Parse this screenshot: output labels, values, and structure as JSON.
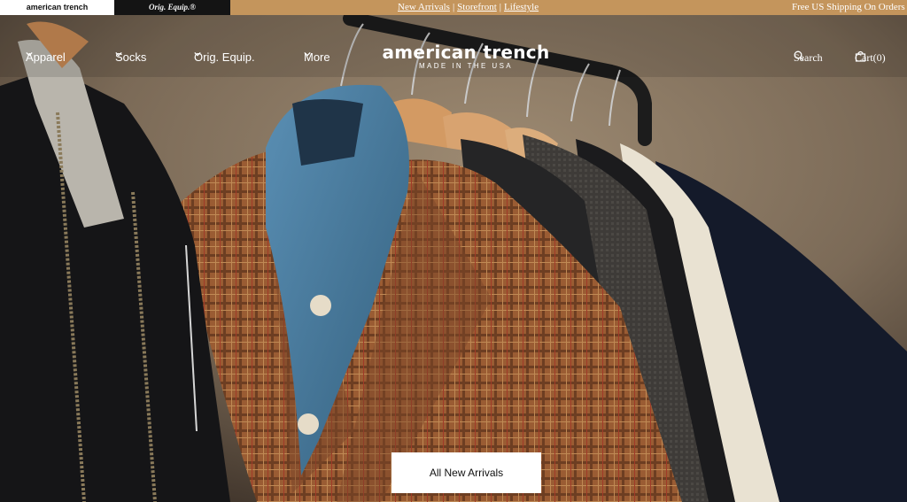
{
  "topbar": {
    "brands": [
      {
        "label": "american trench",
        "active": true
      },
      {
        "label": "Orig. Equip.®",
        "active": false
      }
    ],
    "links": [
      "New Arrivals",
      "Storefront",
      "Lifestyle"
    ],
    "separator": "|",
    "promo": "Free US Shipping On Orders $"
  },
  "nav": {
    "items": [
      {
        "label": "Apparel",
        "icon": "chevron-down-icon"
      },
      {
        "label": "Socks",
        "icon": "chevron-down-icon"
      },
      {
        "label": "Orig. Equip.",
        "icon": "chevron-down-icon"
      },
      {
        "label": "More",
        "icon": "chevron-down-icon"
      }
    ],
    "logo": {
      "name": "american trench",
      "tagline": "MADE IN THE USA"
    },
    "search_label": "Search",
    "cart_label": "Cart(0)"
  },
  "hero": {
    "image": "clothing-rack-photo",
    "cta_label": "All New Arrivals"
  },
  "colors": {
    "topbar_bg": "#c4955c",
    "active_brand_bg": "#ffffff",
    "alt_brand_bg": "#141414",
    "cta_bg": "#ffffff"
  }
}
